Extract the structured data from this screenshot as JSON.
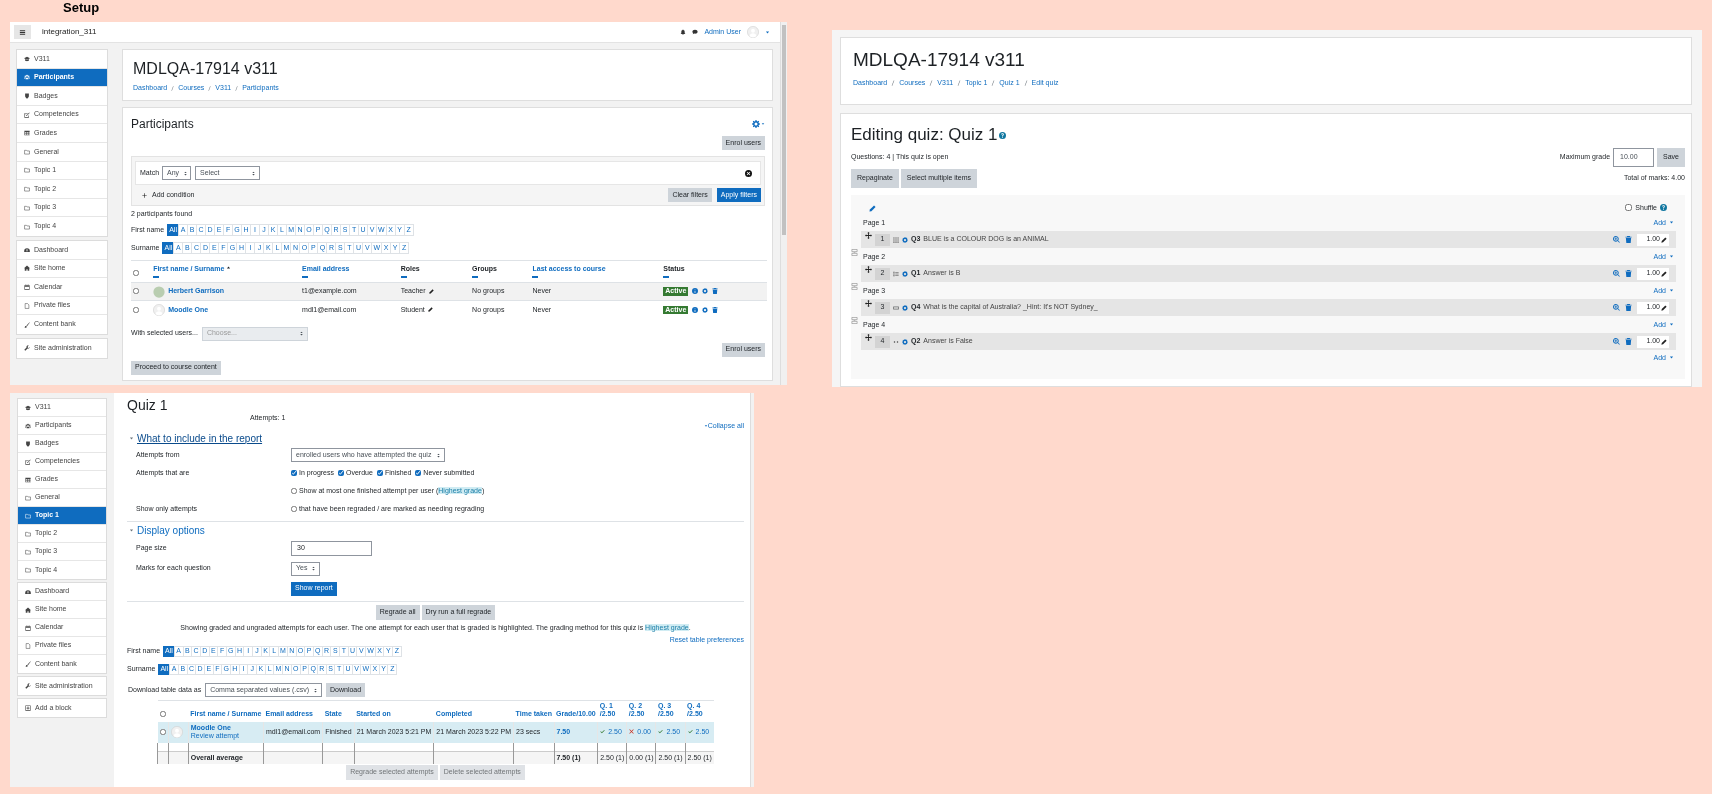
{
  "heading": "Setup",
  "participants_screen": {
    "navbar": {
      "site_name": "integration_311",
      "user_name": "Admin User"
    },
    "sidebar": [
      [
        {
          "label": "V311",
          "kind": "course",
          "selected": false
        },
        {
          "label": "Participants",
          "kind": "participants",
          "selected": true
        },
        {
          "label": "Badges",
          "kind": "badges",
          "selected": false
        },
        {
          "label": "Competencies",
          "kind": "competencies",
          "selected": false
        },
        {
          "label": "Grades",
          "kind": "grades",
          "selected": false
        },
        {
          "label": "General",
          "kind": "section",
          "selected": false
        },
        {
          "label": "Topic 1",
          "kind": "section",
          "selected": false
        },
        {
          "label": "Topic 2",
          "kind": "section",
          "selected": false
        },
        {
          "label": "Topic 3",
          "kind": "section",
          "selected": false
        },
        {
          "label": "Topic 4",
          "kind": "section",
          "selected": false
        }
      ],
      [
        {
          "label": "Dashboard",
          "kind": "dashboard",
          "selected": false
        },
        {
          "label": "Site home",
          "kind": "home",
          "selected": false
        },
        {
          "label": "Calendar",
          "kind": "calendar",
          "selected": false
        },
        {
          "label": "Private files",
          "kind": "files",
          "selected": false
        },
        {
          "label": "Content bank",
          "kind": "content",
          "selected": false
        }
      ],
      [
        {
          "label": "Site administration",
          "kind": "admin",
          "selected": false
        }
      ]
    ],
    "course_title": "MDLQA-17914 v311",
    "breadcrumb": [
      "Dashboard",
      "Courses",
      "V311",
      "Participants"
    ],
    "panel_title": "Participants",
    "enrol_button": "Enrol users",
    "filter": {
      "match_label": "Match",
      "match_value": "Any",
      "condition_value": "Select",
      "add_condition": "Add condition",
      "clear_button": "Clear filters",
      "apply_button": "Apply filters"
    },
    "found_text": "2 participants found",
    "initials_bars": [
      {
        "label": "First name",
        "letters": [
          {
            "label": "All",
            "selected": true
          },
          {
            "label": "A",
            "selected": false
          },
          {
            "label": "B",
            "selected": false
          },
          {
            "label": "C",
            "selected": false
          },
          {
            "label": "D",
            "selected": false
          },
          {
            "label": "E",
            "selected": false
          },
          {
            "label": "F",
            "selected": false
          },
          {
            "label": "G",
            "selected": false
          },
          {
            "label": "H",
            "selected": false
          },
          {
            "label": "I",
            "selected": false
          },
          {
            "label": "J",
            "selected": false
          },
          {
            "label": "K",
            "selected": false
          },
          {
            "label": "L",
            "selected": false
          },
          {
            "label": "M",
            "selected": false
          },
          {
            "label": "N",
            "selected": false
          },
          {
            "label": "O",
            "selected": false
          },
          {
            "label": "P",
            "selected": false
          },
          {
            "label": "Q",
            "selected": false
          },
          {
            "label": "R",
            "selected": false
          },
          {
            "label": "S",
            "selected": false
          },
          {
            "label": "T",
            "selected": false
          },
          {
            "label": "U",
            "selected": false
          },
          {
            "label": "V",
            "selected": false
          },
          {
            "label": "W",
            "selected": false
          },
          {
            "label": "X",
            "selected": false
          },
          {
            "label": "Y",
            "selected": false
          },
          {
            "label": "Z",
            "selected": false
          }
        ]
      },
      {
        "label": "Surname",
        "letters": [
          {
            "label": "All",
            "selected": true
          },
          {
            "label": "A",
            "selected": false
          },
          {
            "label": "B",
            "selected": false
          },
          {
            "label": "C",
            "selected": false
          },
          {
            "label": "D",
            "selected": false
          },
          {
            "label": "E",
            "selected": false
          },
          {
            "label": "F",
            "selected": false
          },
          {
            "label": "G",
            "selected": false
          },
          {
            "label": "H",
            "selected": false
          },
          {
            "label": "I",
            "selected": false
          },
          {
            "label": "J",
            "selected": false
          },
          {
            "label": "K",
            "selected": false
          },
          {
            "label": "L",
            "selected": false
          },
          {
            "label": "M",
            "selected": false
          },
          {
            "label": "N",
            "selected": false
          },
          {
            "label": "O",
            "selected": false
          },
          {
            "label": "P",
            "selected": false
          },
          {
            "label": "Q",
            "selected": false
          },
          {
            "label": "R",
            "selected": false
          },
          {
            "label": "S",
            "selected": false
          },
          {
            "label": "T",
            "selected": false
          },
          {
            "label": "U",
            "selected": false
          },
          {
            "label": "V",
            "selected": false
          },
          {
            "label": "W",
            "selected": false
          },
          {
            "label": "X",
            "selected": false
          },
          {
            "label": "Y",
            "selected": false
          },
          {
            "label": "Z",
            "selected": false
          }
        ]
      }
    ],
    "table": {
      "select_all_checked": false,
      "columns": [
        {
          "label": "First name / Surname",
          "sortable": true,
          "sorted": true
        },
        {
          "label": "Email address",
          "sortable": true,
          "sorted": false
        },
        {
          "label": "Roles",
          "sortable": false,
          "sorted": false
        },
        {
          "label": "Groups",
          "sortable": false,
          "sorted": false
        },
        {
          "label": "Last access to course",
          "sortable": true,
          "sorted": false
        },
        {
          "label": "Status",
          "sortable": false,
          "sorted": false
        }
      ],
      "rows": [
        {
          "name": "Herbert Garrison",
          "avatar": {
            "kind": "photo"
          },
          "email": "t1@example.com",
          "role": "Teacher",
          "groups": "No groups",
          "last_access": "Never",
          "status": "Active",
          "checked": false
        },
        {
          "name": "Moodle One",
          "avatar": {
            "kind": "default"
          },
          "email": "mdl1@email.com",
          "role": "Student",
          "groups": "No groups",
          "last_access": "Never",
          "status": "Active",
          "checked": false
        }
      ]
    },
    "bulk_label": "With selected users...",
    "bulk_placeholder": "Choose...",
    "enrol_button_bottom": "Enrol users",
    "proceed_button": "Proceed to course content"
  },
  "quiz_edit_screen": {
    "course_title": "MDLQA-17914 v311",
    "breadcrumb": [
      "Dashboard",
      "Courses",
      "V311",
      "Topic 1",
      "Quiz 1",
      "Edit quiz"
    ],
    "title": "Editing quiz: Quiz 1",
    "status": "Questions: 4 | This quiz is open",
    "max_grade_label": "Maximum grade",
    "max_grade": "10.00",
    "save_button": "Save",
    "buttons": [
      "Repaginate",
      "Select multiple items"
    ],
    "total_marks": "Total of marks: 4.00",
    "shuffle": {
      "label": "Shuffle",
      "checked": false
    },
    "pages": [
      {
        "label": "Page 1",
        "add": "Add",
        "question": {
          "number": "1",
          "kind": "matching",
          "name": "Q3",
          "text": "BLUE is a COLOUR DOG is an ANIMAL",
          "mark": "1.00"
        }
      },
      {
        "label": "Page 2",
        "add": "Add",
        "question": {
          "number": "2",
          "kind": "multichoice",
          "name": "Q1",
          "text": "Answer is B",
          "mark": "1.00"
        }
      },
      {
        "label": "Page 3",
        "add": "Add",
        "question": {
          "number": "3",
          "kind": "shortanswer",
          "name": "Q4",
          "text": "What is the capital of Australia? _Hint: It's NOT Sydney_",
          "mark": "1.00"
        }
      },
      {
        "label": "Page 4",
        "add": "Add",
        "question": {
          "number": "4",
          "kind": "truefalse",
          "name": "Q2",
          "text": "Answer is False",
          "mark": "1.00"
        }
      }
    ],
    "final_add": "Add"
  },
  "quiz_report_screen": {
    "sidebar": [
      [
        {
          "label": "V311",
          "kind": "course",
          "selected": false
        },
        {
          "label": "Participants",
          "kind": "participants",
          "selected": false
        },
        {
          "label": "Badges",
          "kind": "badges",
          "selected": false
        },
        {
          "label": "Competencies",
          "kind": "competencies",
          "selected": false
        },
        {
          "label": "Grades",
          "kind": "grades",
          "selected": false
        },
        {
          "label": "General",
          "kind": "section",
          "selected": false
        },
        {
          "label": "Topic 1",
          "kind": "section",
          "selected": true
        },
        {
          "label": "Topic 2",
          "kind": "section",
          "selected": false
        },
        {
          "label": "Topic 3",
          "kind": "section",
          "selected": false
        },
        {
          "label": "Topic 4",
          "kind": "section",
          "selected": false
        }
      ],
      [
        {
          "label": "Dashboard",
          "kind": "dashboard",
          "selected": false
        },
        {
          "label": "Site home",
          "kind": "home",
          "selected": false
        },
        {
          "label": "Calendar",
          "kind": "calendar",
          "selected": false
        },
        {
          "label": "Private files",
          "kind": "files",
          "selected": false
        },
        {
          "label": "Content bank",
          "kind": "content",
          "selected": false
        }
      ],
      [
        {
          "label": "Site administration",
          "kind": "admin",
          "selected": false
        }
      ],
      [
        {
          "label": "Add a block",
          "kind": "block",
          "selected": false
        }
      ]
    ],
    "title": "Quiz 1",
    "attempts_summary": "Attempts: 1",
    "collapse_all": "Collapse all",
    "sections": [
      {
        "title": "What to include in the report",
        "expanded": true,
        "focused": true,
        "fields": [
          {
            "kind": "select",
            "label": "Attempts from",
            "value": "enrolled users who have attempted the quiz"
          },
          {
            "kind": "checkboxes",
            "label": "Attempts that are",
            "options": [
              {
                "label": "In progress",
                "checked": true
              },
              {
                "label": "Overdue",
                "checked": true
              },
              {
                "label": "Finished",
                "checked": true
              },
              {
                "label": "Never submitted",
                "checked": true
              }
            ]
          },
          {
            "kind": "checkbox",
            "text": "Show at most one finished attempt per user (",
            "highlight": "Highest grade",
            "text_after": ")",
            "checked": false
          },
          {
            "kind": "checkbox",
            "label": "Show only attempts",
            "text": "that have been regraded / are marked as needing regrading",
            "checked": false
          }
        ]
      },
      {
        "title": "Display options",
        "expanded": true,
        "focused": false,
        "fields": [
          {
            "kind": "text",
            "label": "Page size",
            "value": "30"
          },
          {
            "kind": "select",
            "label": "Marks for each question",
            "value": "Yes"
          },
          {
            "kind": "button",
            "text": "Show report"
          }
        ]
      }
    ],
    "regrade_buttons": [
      "Regrade all",
      "Dry run a full regrade"
    ],
    "info": {
      "text": "Showing graded and ungraded attempts for each user. The one attempt for each user that is graded is highlighted. The grading method for this quiz is ",
      "highlight": "Highest grade",
      "text_after": "."
    },
    "reset_link": "Reset table preferences",
    "initials_bars": [
      {
        "label": "First name",
        "letters": [
          {
            "label": "All",
            "selected": true
          },
          {
            "label": "A",
            "selected": false
          },
          {
            "label": "B",
            "selected": false
          },
          {
            "label": "C",
            "selected": false
          },
          {
            "label": "D",
            "selected": false
          },
          {
            "label": "E",
            "selected": false
          },
          {
            "label": "F",
            "selected": false
          },
          {
            "label": "G",
            "selected": false
          },
          {
            "label": "H",
            "selected": false
          },
          {
            "label": "I",
            "selected": false
          },
          {
            "label": "J",
            "selected": false
          },
          {
            "label": "K",
            "selected": false
          },
          {
            "label": "L",
            "selected": false
          },
          {
            "label": "M",
            "selected": false
          },
          {
            "label": "N",
            "selected": false
          },
          {
            "label": "O",
            "selected": false
          },
          {
            "label": "P",
            "selected": false
          },
          {
            "label": "Q",
            "selected": false
          },
          {
            "label": "R",
            "selected": false
          },
          {
            "label": "S",
            "selected": false
          },
          {
            "label": "T",
            "selected": false
          },
          {
            "label": "U",
            "selected": false
          },
          {
            "label": "V",
            "selected": false
          },
          {
            "label": "W",
            "selected": false
          },
          {
            "label": "X",
            "selected": false
          },
          {
            "label": "Y",
            "selected": false
          },
          {
            "label": "Z",
            "selected": false
          }
        ]
      },
      {
        "label": "Surname",
        "letters": [
          {
            "label": "All",
            "selected": true
          },
          {
            "label": "A",
            "selected": false
          },
          {
            "label": "B",
            "selected": false
          },
          {
            "label": "C",
            "selected": false
          },
          {
            "label": "D",
            "selected": false
          },
          {
            "label": "E",
            "selected": false
          },
          {
            "label": "F",
            "selected": false
          },
          {
            "label": "G",
            "selected": false
          },
          {
            "label": "H",
            "selected": false
          },
          {
            "label": "I",
            "selected": false
          },
          {
            "label": "J",
            "selected": false
          },
          {
            "label": "K",
            "selected": false
          },
          {
            "label": "L",
            "selected": false
          },
          {
            "label": "M",
            "selected": false
          },
          {
            "label": "N",
            "selected": false
          },
          {
            "label": "O",
            "selected": false
          },
          {
            "label": "P",
            "selected": false
          },
          {
            "label": "Q",
            "selected": false
          },
          {
            "label": "R",
            "selected": false
          },
          {
            "label": "S",
            "selected": false
          },
          {
            "label": "T",
            "selected": false
          },
          {
            "label": "U",
            "selected": false
          },
          {
            "label": "V",
            "selected": false
          },
          {
            "label": "W",
            "selected": false
          },
          {
            "label": "X",
            "selected": false
          },
          {
            "label": "Y",
            "selected": false
          },
          {
            "label": "Z",
            "selected": false
          }
        ]
      }
    ],
    "download": {
      "label": "Download table data as",
      "format": "Comma separated values (.csv)",
      "button": "Download"
    },
    "attempts_table": {
      "select_all_checked": false,
      "columns": [
        {
          "label": "First name / Surname"
        },
        {
          "label": "Email address"
        },
        {
          "label": "State"
        },
        {
          "label": "Started on"
        },
        {
          "label": "Completed"
        },
        {
          "label": "Time taken"
        },
        {
          "label": "Grade/10.00"
        },
        {
          "label": "Q. 1",
          "max": "/2.50"
        },
        {
          "label": "Q. 2",
          "max": "/2.50"
        },
        {
          "label": "Q. 3",
          "max": "/2.50"
        },
        {
          "label": "Q. 4",
          "max": "/2.50"
        }
      ],
      "rows": [
        {
          "name": "Moodle One",
          "link": "Review attempt",
          "email": "mdl1@email.com",
          "state": "Finished",
          "started": "21 March 2023 5:21 PM",
          "completed": "21 March 2023 5:22 PM",
          "time_taken": "23 secs",
          "grade": "7.50",
          "checked": false,
          "highlighted": true,
          "marks": [
            {
              "value": "2.50",
              "correct": true
            },
            {
              "value": "0.00",
              "correct": false
            },
            {
              "value": "2.50",
              "correct": true
            },
            {
              "value": "2.50",
              "correct": true
            }
          ]
        }
      ],
      "average": {
        "label": "Overall average",
        "grade": "7.50 (1)",
        "marks": [
          "2.50 (1)",
          "0.00 (1)",
          "2.50 (1)",
          "2.50 (1)"
        ]
      }
    },
    "bulk_buttons": [
      {
        "label": "Regrade selected attempts",
        "disabled": true
      },
      {
        "label": "Delete selected attempts",
        "disabled": true
      }
    ]
  }
}
